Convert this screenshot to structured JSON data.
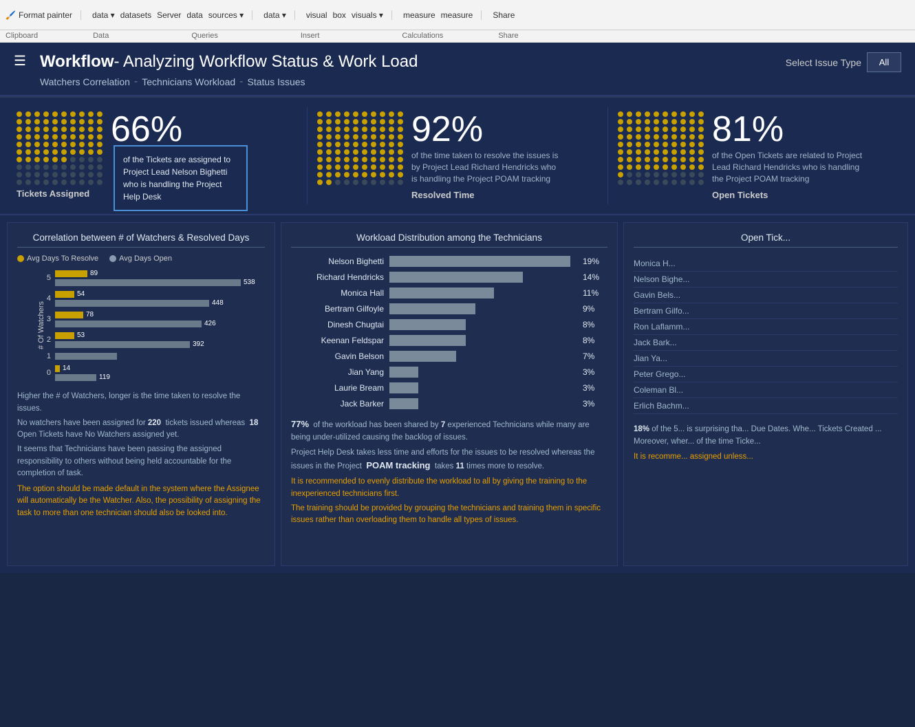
{
  "toolbar": {
    "items": [
      {
        "label": "Format painter",
        "section": "Clipboard"
      },
      {
        "label": "data ▾",
        "section": ""
      },
      {
        "label": "datasets",
        "section": ""
      },
      {
        "label": "Server",
        "section": ""
      },
      {
        "label": "data",
        "section": ""
      },
      {
        "label": "sources ▾",
        "section": "Data"
      },
      {
        "label": "data ▾",
        "section": "Queries"
      },
      {
        "label": "visual",
        "section": ""
      },
      {
        "label": "box",
        "section": ""
      },
      {
        "label": "visuals ▾",
        "section": "Insert"
      },
      {
        "label": "measure",
        "section": ""
      },
      {
        "label": "measure",
        "section": "Calculations"
      },
      {
        "label": "Share",
        "section": "Share"
      }
    ],
    "sections": [
      "Clipboard",
      "Data",
      "Queries",
      "Insert",
      "Calculations",
      "Share"
    ]
  },
  "header": {
    "title_bold": "Workflow",
    "title_rest": "- Analyzing Workflow Status & Work Load",
    "nav": [
      {
        "label": "Watchers Correlation"
      },
      {
        "sep": "-"
      },
      {
        "label": "Technicians Workload"
      },
      {
        "sep": "-"
      },
      {
        "label": "Status Issues"
      }
    ],
    "select_issue_label": "Select Issue Type",
    "select_issue_value": "All"
  },
  "kpis": [
    {
      "percent": "66%",
      "text": "of the Tickets are assigned to Project Lead Nelson Bighetti who is handling the Project Help Desk",
      "label": "Tickets Assigned",
      "tooltip": "of the Tickets are assigned to Project Lead Nelson Bighetti who is handling the Project Help Desk",
      "dots_filled": 66,
      "dots_total": 100
    },
    {
      "percent": "92%",
      "text": "of the time taken to resolve the issues is by Project Lead Richard Hendricks who is handling the Project POAM tracking",
      "label": "Resolved Time",
      "dots_filled": 92,
      "dots_total": 100
    },
    {
      "percent": "81%",
      "text": "of the Open Tickets are related to Project Lead Richard Hendricks who is handling the Project POAM tracking",
      "label": "Open Tickets",
      "dots_filled": 81,
      "dots_total": 100
    }
  ],
  "watcher_chart": {
    "title": "Correlation between # of Watchers & Resolved Days",
    "legend": [
      "Avg Days To Resolve",
      "Avg Days Open"
    ],
    "rows": [
      {
        "label": "5",
        "gold": 89,
        "gray": 538,
        "gold_display": 89,
        "gray_display": 538
      },
      {
        "label": "4",
        "gold": 54,
        "gray": 448,
        "gold_display": 54,
        "gray_display": 448
      },
      {
        "label": "3",
        "gold": 78,
        "gray": 426,
        "gold_display": 78,
        "gray_display": 426
      },
      {
        "label": "2",
        "gold": 53,
        "gray": 392,
        "gold_display": 53,
        "gray_display": 392
      },
      {
        "label": "1",
        "gold": 0,
        "gray": 180,
        "gold_display": "",
        "gray_display": ""
      },
      {
        "label": "0",
        "gold": 14,
        "gray": 119,
        "gold_display": 14,
        "gray_display": 119
      }
    ],
    "y_axis_label": "# Of Watchers",
    "analysis": [
      "Higher the # of Watchers, longer is the time taken to resolve the issues.",
      "No watchers have been assigned for 220  tickets issued whereas  18 Open Tickets have No Watchers assigned yet.",
      "It seems that Technicians have been passing the assigned responsibility to others without being held accountable for the completion of task."
    ],
    "orange_text": "The option should be made default in the system where the Assignee will automatically be the Watcher. Also, the possibility of assigning the task to more than one technician should also be looked into."
  },
  "workload_chart": {
    "title": "Workload Distribution among the Technicians",
    "rows": [
      {
        "name": "Nelson Bighetti",
        "pct": 19,
        "pct_label": "19%"
      },
      {
        "name": "Richard Hendricks",
        "pct": 14,
        "pct_label": "14%"
      },
      {
        "name": "Monica Hall",
        "pct": 11,
        "pct_label": "11%"
      },
      {
        "name": "Bertram Gilfoyle",
        "pct": 9,
        "pct_label": "9%"
      },
      {
        "name": "Dinesh Chugtai",
        "pct": 8,
        "pct_label": "8%"
      },
      {
        "name": "Keenan Feldspar",
        "pct": 8,
        "pct_label": "8%"
      },
      {
        "name": "Gavin Belson",
        "pct": 7,
        "pct_label": "7%"
      },
      {
        "name": "Jian Yang",
        "pct": 3,
        "pct_label": "3%"
      },
      {
        "name": "Laurie Bream",
        "pct": 3,
        "pct_label": "3%"
      },
      {
        "name": "Jack Barker",
        "pct": 3,
        "pct_label": "3%"
      }
    ],
    "analysis_plain": [
      "77%  of the workload has been shared by 7 experienced Technicians while many are being under-utilized causing the backlog of issues.",
      "Project Help Desk takes less time and efforts for the issues to be resolved whereas the issues in the Project  POAM tracking  takes 11 times more to resolve."
    ],
    "analysis_orange": [
      "It is recommended to evenly distribute the workload to all by giving the training to the inexperienced technicians first.",
      "The training should be provided by grouping the technicians and training them in specific issues rather than overloading them to handle all types of issues."
    ]
  },
  "open_tickets": {
    "title": "Open Tick...",
    "names": [
      "Monica H...",
      "Nelson Bighe...",
      "Gavin Bels...",
      "Bertram Gilfo...",
      "Ron Laflamm...",
      "Jack Bark...",
      "Jian Ya...",
      "Peter Grego...",
      "Coleman Bl...",
      "Erlich Bachm..."
    ],
    "analysis": "18% of the 5... is surprising tha... Due Dates. Whe... Tickets Created ... Moreover, wher... of the time Ticke... It is recomme... assigned unless..."
  }
}
